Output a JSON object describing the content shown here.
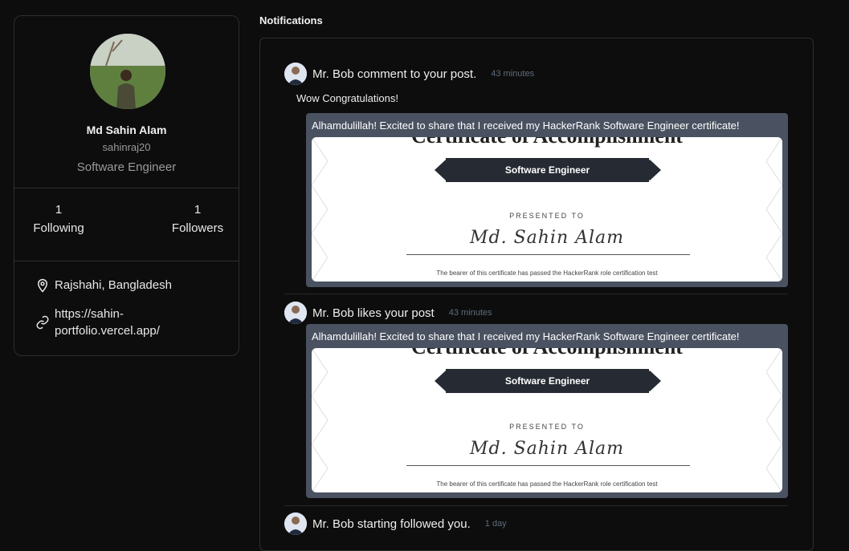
{
  "profile": {
    "name": "Md Sahin Alam",
    "username": "sahinraj20",
    "title": "Software Engineer",
    "following_count": "1",
    "following_label": "Following",
    "followers_count": "1",
    "followers_label": "Followers",
    "location": "Rajshahi, Bangladesh",
    "website": "https://sahin-portfolio.vercel.app/"
  },
  "notifications": {
    "heading": "Notifications",
    "items": [
      {
        "text": "Mr. Bob comment to your post.",
        "time": "43 minutes",
        "comment": "Wow Congratulations!",
        "post": {
          "caption": "Alhamdulillah! Excited to share that I received my HackerRank Software Engineer certificate!",
          "cert_heading": "Certificate of Accomplishment",
          "cert_role": "Software Engineer",
          "cert_presented": "PRESENTED TO",
          "cert_name": "Md. Sahin Alam",
          "cert_footer": "The bearer of this certificate has passed the HackerRank role certification test"
        }
      },
      {
        "text": "Mr. Bob likes your post",
        "time": "43 minutes",
        "post": {
          "caption": "Alhamdulillah! Excited to share that I received my HackerRank Software Engineer certificate!",
          "cert_heading": "Certificate of Accomplishment",
          "cert_role": "Software Engineer",
          "cert_presented": "PRESENTED TO",
          "cert_name": "Md. Sahin Alam",
          "cert_footer": "The bearer of this certificate has passed the HackerRank role certification test"
        }
      },
      {
        "text": "Mr. Bob starting followed you.",
        "time": "1 day"
      }
    ]
  },
  "icons": {
    "location": "map-pin-icon",
    "link": "link-icon"
  },
  "colors": {
    "background": "#0d0d0d",
    "card_border": "#2e2e2e",
    "post_card": "#4a5261",
    "banner": "#262b33",
    "time": "#5f6b7a"
  }
}
